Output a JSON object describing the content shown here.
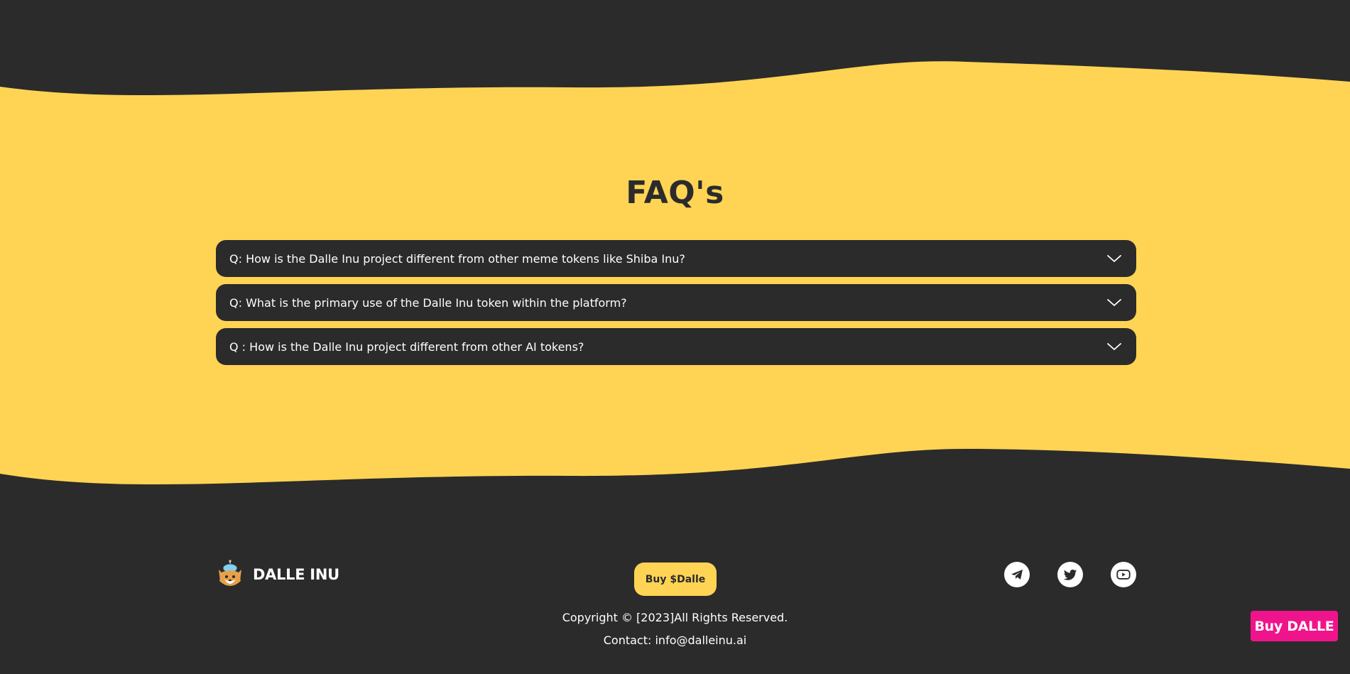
{
  "colors": {
    "dark": "#2b2b2b",
    "yellow": "#ffd454",
    "white": "#ffffff",
    "pink": "#f0148c"
  },
  "faq": {
    "title": "FAQ's",
    "items": [
      {
        "question": "Q: How is the Dalle Inu project different from other meme tokens like Shiba Inu?",
        "icon": "chevron-down-icon"
      },
      {
        "question": "Q: What is the primary use of the Dalle Inu token within the platform?",
        "icon": "chevron-down-icon"
      },
      {
        "question": "Q : How is the Dalle Inu project different from other AI tokens?",
        "icon": "chevron-down-icon"
      }
    ]
  },
  "footer": {
    "brand_name": "DALLE INU",
    "buy_button_label": "Buy $Dalle",
    "social": [
      "telegram-icon",
      "twitter-icon",
      "youtube-icon"
    ],
    "copyright": "Copyright © [2023]All Rights Reserved.",
    "contact": "Contact: info@dalleinu.ai"
  },
  "floating_button": {
    "label": "Buy DALLE"
  }
}
